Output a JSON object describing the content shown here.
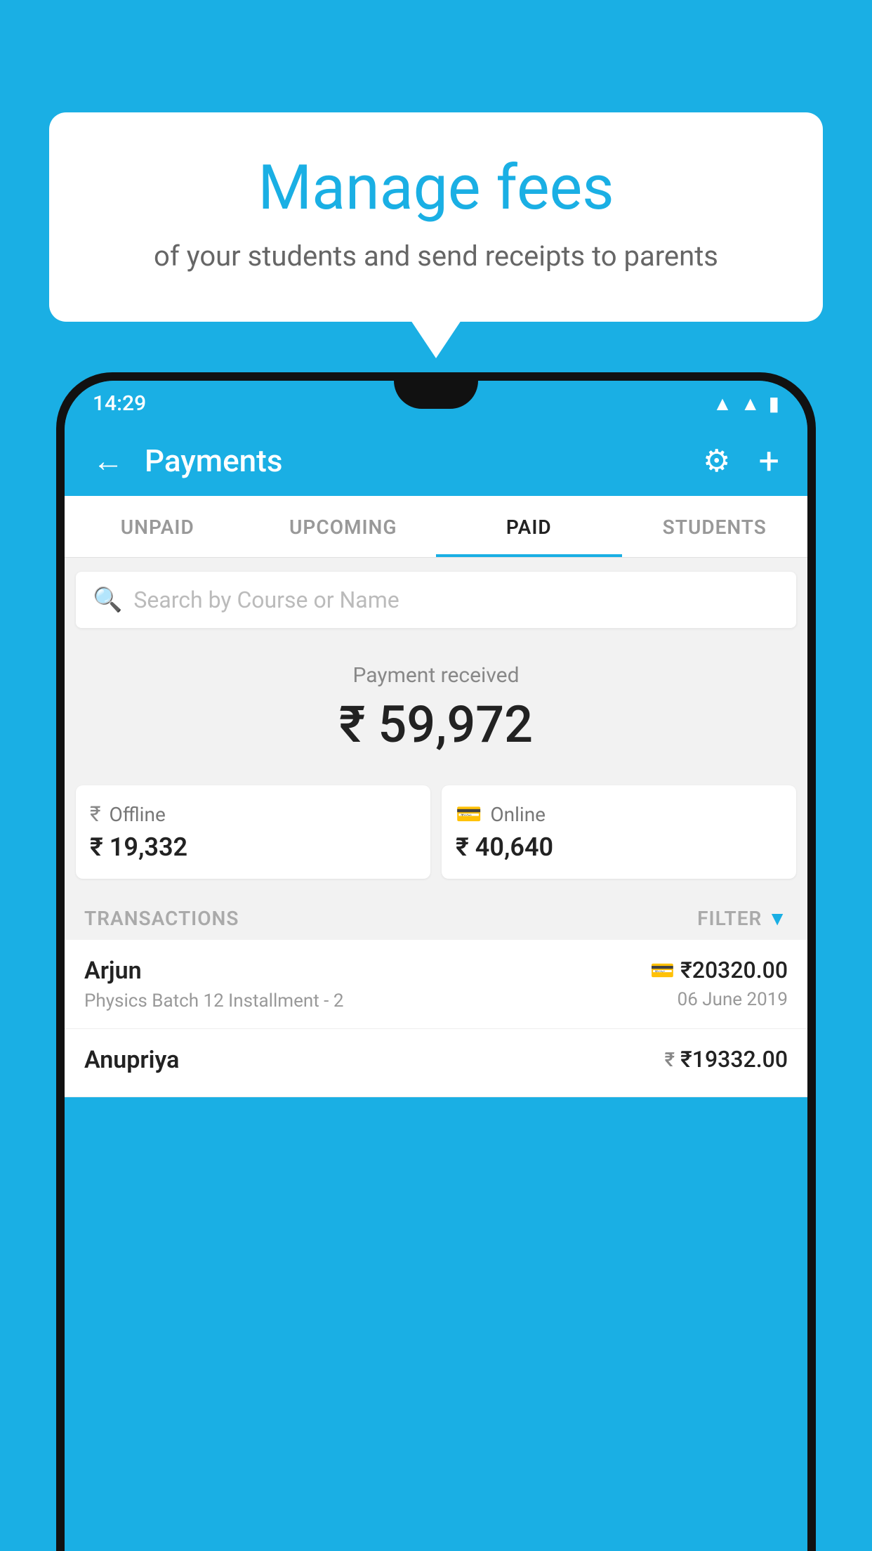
{
  "background_color": "#1AAFE4",
  "bubble": {
    "title": "Manage fees",
    "subtitle": "of your students and send receipts to parents"
  },
  "status_bar": {
    "time": "14:29",
    "icons": [
      "wifi",
      "signal",
      "battery"
    ]
  },
  "app_bar": {
    "title": "Payments",
    "back_label": "←",
    "gear_label": "⚙",
    "plus_label": "+"
  },
  "tabs": [
    {
      "label": "UNPAID",
      "active": false
    },
    {
      "label": "UPCOMING",
      "active": false
    },
    {
      "label": "PAID",
      "active": true
    },
    {
      "label": "STUDENTS",
      "active": false
    }
  ],
  "search": {
    "placeholder": "Search by Course or Name"
  },
  "payment_summary": {
    "label": "Payment received",
    "amount": "₹ 59,972",
    "offline": {
      "icon": "rupee-note",
      "label": "Offline",
      "amount": "₹ 19,332"
    },
    "online": {
      "icon": "card",
      "label": "Online",
      "amount": "₹ 40,640"
    }
  },
  "transactions_section": {
    "label": "TRANSACTIONS",
    "filter_label": "FILTER"
  },
  "transactions": [
    {
      "name": "Arjun",
      "detail": "Physics Batch 12 Installment - 2",
      "amount": "₹20320.00",
      "date": "06 June 2019",
      "payment_type": "card"
    },
    {
      "name": "Anupriya",
      "detail": "",
      "amount": "₹19332.00",
      "date": "",
      "payment_type": "rupee"
    }
  ]
}
